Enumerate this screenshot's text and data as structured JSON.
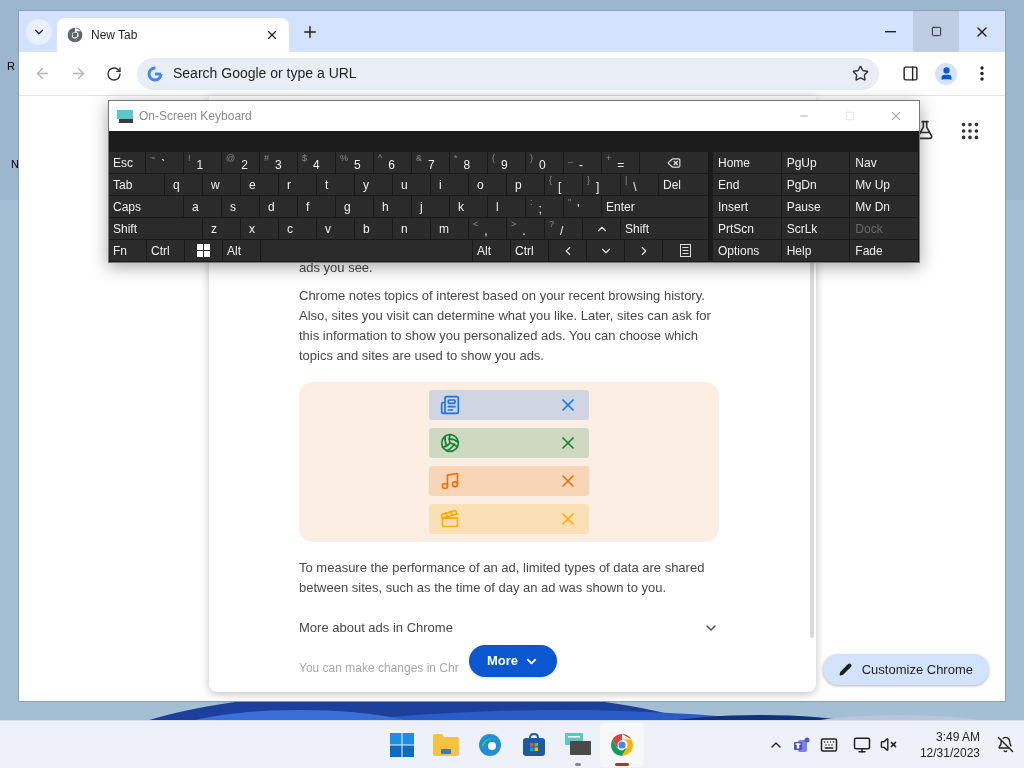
{
  "desktop": {
    "icon_labels": [
      {
        "label": "R"
      },
      {
        "label": "N"
      }
    ]
  },
  "browser": {
    "tabs": [
      {
        "title": "New Tab",
        "selected": true
      }
    ],
    "omnibox": {
      "placeholder": "Search Google or type a URL"
    },
    "dialog": {
      "top_text": "ads you see.",
      "paragraphs": [
        "Chrome notes topics of interest based on your recent browsing history. Also, sites you visit can determine what you like. Later, sites can ask for this information to show you personalized ads. You can choose which topics and sites are used to show you ads.",
        "To measure the performance of an ad, limited types of data are shared between sites, such as the time of day an ad was shown to you."
      ],
      "topics": [
        {
          "kind": "news",
          "color": "#1a73e8"
        },
        {
          "kind": "sports",
          "color": "#188038"
        },
        {
          "kind": "music",
          "color": "#e8710a"
        },
        {
          "kind": "movies",
          "color": "#f9ab00"
        }
      ],
      "expander": {
        "label": "More about ads in Chrome",
        "expanded": false
      },
      "faded_text": "You can make changes in Chr",
      "more_button": "More"
    },
    "customize_button": "Customize Chrome"
  },
  "keyboard": {
    "title": "On-Screen Keyboard",
    "key_rows": [
      [
        {
          "kind": "text",
          "label": "Esc"
        },
        {
          "kind": "symbol",
          "shift": "~",
          "label": "`"
        },
        {
          "kind": "symbol",
          "shift": "!",
          "label": "1"
        },
        {
          "kind": "symbol",
          "shift": "@",
          "label": "2"
        },
        {
          "kind": "symbol",
          "shift": "#",
          "label": "3"
        },
        {
          "kind": "symbol",
          "shift": "$",
          "label": "4"
        },
        {
          "kind": "symbol",
          "shift": "%",
          "label": "5"
        },
        {
          "kind": "symbol",
          "shift": "^",
          "label": "6"
        },
        {
          "kind": "symbol",
          "shift": "&",
          "label": "7"
        },
        {
          "kind": "symbol",
          "shift": "*",
          "label": "8"
        },
        {
          "kind": "symbol",
          "shift": "(",
          "label": "9"
        },
        {
          "kind": "symbol",
          "shift": ")",
          "label": "0"
        },
        {
          "kind": "symbol",
          "shift": "_",
          "label": "-"
        },
        {
          "kind": "symbol",
          "shift": "+",
          "label": "="
        },
        {
          "kind": "backspace"
        }
      ],
      [
        {
          "kind": "text",
          "label": "Tab"
        },
        {
          "kind": "letter",
          "label": "q"
        },
        {
          "kind": "letter",
          "label": "w"
        },
        {
          "kind": "letter",
          "label": "e"
        },
        {
          "kind": "letter",
          "label": "r"
        },
        {
          "kind": "letter",
          "label": "t"
        },
        {
          "kind": "letter",
          "label": "y"
        },
        {
          "kind": "letter",
          "label": "u"
        },
        {
          "kind": "letter",
          "label": "i"
        },
        {
          "kind": "letter",
          "label": "o"
        },
        {
          "kind": "letter",
          "label": "p"
        },
        {
          "kind": "symbol",
          "shift": "{",
          "label": "["
        },
        {
          "kind": "symbol",
          "shift": "}",
          "label": "]"
        },
        {
          "kind": "symbol",
          "shift": "|",
          "label": "\\"
        },
        {
          "kind": "text",
          "label": "Del"
        }
      ],
      [
        {
          "kind": "text",
          "label": "Caps"
        },
        {
          "kind": "letter",
          "label": "a"
        },
        {
          "kind": "letter",
          "label": "s"
        },
        {
          "kind": "letter",
          "label": "d"
        },
        {
          "kind": "letter",
          "label": "f"
        },
        {
          "kind": "letter",
          "label": "g"
        },
        {
          "kind": "letter",
          "label": "h"
        },
        {
          "kind": "letter",
          "label": "j"
        },
        {
          "kind": "letter",
          "label": "k"
        },
        {
          "kind": "letter",
          "label": "l"
        },
        {
          "kind": "symbol",
          "shift": ":",
          "label": ";"
        },
        {
          "kind": "symbol",
          "shift": "\"",
          "label": "'"
        },
        {
          "kind": "text",
          "label": "Enter"
        }
      ],
      [
        {
          "kind": "text",
          "label": "Shift"
        },
        {
          "kind": "letter",
          "label": "z"
        },
        {
          "kind": "letter",
          "label": "x"
        },
        {
          "kind": "letter",
          "label": "c"
        },
        {
          "kind": "letter",
          "label": "v"
        },
        {
          "kind": "letter",
          "label": "b"
        },
        {
          "kind": "letter",
          "label": "n"
        },
        {
          "kind": "letter",
          "label": "m"
        },
        {
          "kind": "symbol",
          "shift": "<",
          "label": ","
        },
        {
          "kind": "symbol",
          "shift": ">",
          "label": "."
        },
        {
          "kind": "symbol",
          "shift": "?",
          "label": "/"
        },
        {
          "kind": "up"
        },
        {
          "kind": "text",
          "label": "Shift"
        }
      ],
      [
        {
          "kind": "text",
          "label": "Fn"
        },
        {
          "kind": "text",
          "label": "Ctrl"
        },
        {
          "kind": "windows"
        },
        {
          "kind": "text",
          "label": "Alt"
        },
        {
          "kind": "space"
        },
        {
          "kind": "text",
          "label": "Alt"
        },
        {
          "kind": "text",
          "label": "Ctrl"
        },
        {
          "kind": "left"
        },
        {
          "kind": "down"
        },
        {
          "kind": "right"
        },
        {
          "kind": "menu"
        }
      ]
    ],
    "nav_rows": [
      [
        {
          "label": "Home",
          "disabled": false
        },
        {
          "label": "PgUp",
          "disabled": false
        },
        {
          "label": "Nav",
          "disabled": false
        }
      ],
      [
        {
          "label": "End",
          "disabled": false
        },
        {
          "label": "PgDn",
          "disabled": false
        },
        {
          "label": "Mv Up",
          "disabled": false
        }
      ],
      [
        {
          "label": "Insert",
          "disabled": false
        },
        {
          "label": "Pause",
          "disabled": false
        },
        {
          "label": "Mv Dn",
          "disabled": false
        }
      ],
      [
        {
          "label": "PrtScn",
          "disabled": false
        },
        {
          "label": "ScrLk",
          "disabled": false
        },
        {
          "label": "Dock",
          "disabled": true
        }
      ],
      [
        {
          "label": "Options",
          "disabled": false
        },
        {
          "label": "Help",
          "disabled": false
        },
        {
          "label": "Fade",
          "disabled": false
        }
      ]
    ]
  },
  "taskbar": {
    "apps": [
      {
        "kind": "start",
        "running": false,
        "focused": false
      },
      {
        "kind": "explorer",
        "running": false,
        "focused": false
      },
      {
        "kind": "edge",
        "running": false,
        "focused": false
      },
      {
        "kind": "store",
        "running": false,
        "focused": false
      },
      {
        "kind": "keyboard",
        "running": true,
        "focused": false
      },
      {
        "kind": "chrome",
        "running": true,
        "focused": true
      }
    ],
    "clock": {
      "time": "3:49 AM",
      "date": "12/31/2023"
    }
  }
}
